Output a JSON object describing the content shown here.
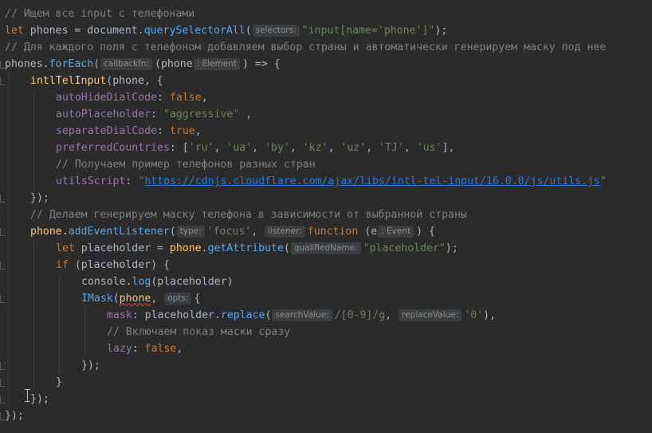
{
  "editor": {
    "lines": [
      {
        "indent": 0,
        "tokens": [
          {
            "t": "// Ищем все input с телефонами",
            "c": "t-comment"
          }
        ]
      },
      {
        "indent": 0,
        "tokens": [
          {
            "t": "let",
            "c": "t-kw"
          },
          {
            "t": " phones = document."
          },
          {
            "t": "querySelectorAll",
            "c": "t-method"
          },
          {
            "t": "("
          },
          {
            "hint": "selectors:"
          },
          {
            "t": "\"input[name='phone']\"",
            "c": "t-str"
          },
          {
            "t": ");"
          }
        ]
      },
      {
        "indent": 0,
        "tokens": [
          {
            "t": "// Для каждого поля с телефоном добавляем выбор страны и автоматически генерируем маску под нее",
            "c": "t-comment"
          }
        ]
      },
      {
        "indent": 0,
        "tokens": [
          {
            "t": "phones."
          },
          {
            "t": "forEach",
            "c": "t-method"
          },
          {
            "t": "("
          },
          {
            "hint": "callbackfn:"
          },
          {
            "t": "("
          },
          {
            "t": "phone",
            "c": "t-var"
          },
          {
            "hint": ": Element"
          },
          {
            "t": ") => {"
          }
        ]
      },
      {
        "indent": 1,
        "tokens": [
          {
            "t": "intlTelInput",
            "c": "t-fn"
          },
          {
            "t": "(phone, {"
          }
        ]
      },
      {
        "indent": 2,
        "tokens": [
          {
            "t": "autoHideDialCode",
            "c": "t-prop"
          },
          {
            "t": ": "
          },
          {
            "t": "false",
            "c": "t-kw"
          },
          {
            "t": ","
          }
        ]
      },
      {
        "indent": 2,
        "tokens": [
          {
            "t": "autoPlaceholder",
            "c": "t-prop"
          },
          {
            "t": ": "
          },
          {
            "t": "\"aggressive\"",
            "c": "t-str"
          },
          {
            "t": " ,"
          }
        ]
      },
      {
        "indent": 2,
        "tokens": [
          {
            "t": "separateDialCode",
            "c": "t-prop"
          },
          {
            "t": ": "
          },
          {
            "t": "true",
            "c": "t-kw"
          },
          {
            "t": ","
          }
        ]
      },
      {
        "indent": 2,
        "tokens": [
          {
            "t": "preferredCountries",
            "c": "t-prop"
          },
          {
            "t": ": ["
          },
          {
            "t": "'ru'",
            "c": "t-str"
          },
          {
            "t": ", "
          },
          {
            "t": "'ua'",
            "c": "t-str"
          },
          {
            "t": ", "
          },
          {
            "t": "'by'",
            "c": "t-str"
          },
          {
            "t": ", "
          },
          {
            "t": "'kz'",
            "c": "t-str"
          },
          {
            "t": ", "
          },
          {
            "t": "'uz'",
            "c": "t-str"
          },
          {
            "t": ", "
          },
          {
            "t": "'TJ'",
            "c": "t-str"
          },
          {
            "t": ", "
          },
          {
            "t": "'us'",
            "c": "t-str"
          },
          {
            "t": "],"
          }
        ]
      },
      {
        "indent": 2,
        "tokens": [
          {
            "t": "// Получаем пример телефонов разных стран",
            "c": "t-comment"
          }
        ]
      },
      {
        "indent": 2,
        "tokens": [
          {
            "t": "utilsScript",
            "c": "t-prop"
          },
          {
            "t": ": "
          },
          {
            "t": "\"",
            "c": "t-str"
          },
          {
            "t": "https://cdnjs.cloudflare.com/ajax/libs/intl-tel-input/16.0.0/js/utils.js",
            "c": "t-url"
          },
          {
            "t": "\"",
            "c": "t-str"
          }
        ]
      },
      {
        "indent": 1,
        "tokens": [
          {
            "t": "});"
          }
        ]
      },
      {
        "indent": 1,
        "tokens": [
          {
            "t": "// Делаем генерируем маску телефона в зависимости от выбранной страны",
            "c": "t-comment"
          }
        ]
      },
      {
        "indent": 1,
        "tokens": [
          {
            "t": "phone.",
            "c": "t-fn"
          },
          {
            "t": "addEventListener",
            "c": "t-method"
          },
          {
            "t": "("
          },
          {
            "hint": "type:"
          },
          {
            "t": "'focus'",
            "c": "t-str"
          },
          {
            "t": ", "
          },
          {
            "hint": "listener:"
          },
          {
            "t": "function",
            "c": "t-kw"
          },
          {
            "t": " (e"
          },
          {
            "hint": ": Event"
          },
          {
            "t": ") {"
          }
        ]
      },
      {
        "indent": 2,
        "tokens": [
          {
            "t": "let",
            "c": "t-kw"
          },
          {
            "t": " placeholder = "
          },
          {
            "t": "phone",
            "c": "t-fn"
          },
          {
            "t": "."
          },
          {
            "t": "getAttribute",
            "c": "t-method"
          },
          {
            "t": "("
          },
          {
            "hint": "qualifiedName:"
          },
          {
            "t": "\"placeholder\"",
            "c": "t-str"
          },
          {
            "t": ");"
          }
        ]
      },
      {
        "indent": 2,
        "tokens": [
          {
            "t": "if",
            "c": "t-kw"
          },
          {
            "t": " (placeholder) {"
          }
        ]
      },
      {
        "indent": 3,
        "tokens": [
          {
            "t": "console."
          },
          {
            "t": "log",
            "c": "t-method"
          },
          {
            "t": "(placeholder)"
          }
        ]
      },
      {
        "indent": 3,
        "tokens": [
          {
            "t": "IMask",
            "c": "t-method"
          },
          {
            "t": "("
          },
          {
            "t": "phone",
            "c": "t-fn t-warn"
          },
          {
            "t": ", "
          },
          {
            "hint": "opts:"
          },
          {
            "t": "{"
          }
        ]
      },
      {
        "indent": 4,
        "tokens": [
          {
            "t": "mask",
            "c": "t-prop"
          },
          {
            "t": ": placeholder."
          },
          {
            "t": "replace",
            "c": "t-method"
          },
          {
            "t": "("
          },
          {
            "hint": "searchValue:"
          },
          {
            "t": "/[0-9]/g",
            "c": "t-str"
          },
          {
            "t": ", "
          },
          {
            "hint": "replaceValue:"
          },
          {
            "t": "'0'",
            "c": "t-str"
          },
          {
            "t": "),"
          }
        ]
      },
      {
        "indent": 4,
        "tokens": [
          {
            "t": "// Включаем показ маски сразу",
            "c": "t-comment"
          }
        ]
      },
      {
        "indent": 4,
        "tokens": [
          {
            "t": "lazy",
            "c": "t-prop"
          },
          {
            "t": ": "
          },
          {
            "t": "false",
            "c": "t-kw"
          },
          {
            "t": ","
          }
        ]
      },
      {
        "indent": 3,
        "tokens": [
          {
            "t": "});"
          }
        ]
      },
      {
        "indent": 2,
        "tokens": [
          {
            "t": "}"
          }
        ]
      },
      {
        "indent": 1,
        "tokens": [
          {
            "t": "});"
          }
        ]
      },
      {
        "indent": 0,
        "tokens": [
          {
            "t": "});"
          }
        ]
      }
    ]
  }
}
